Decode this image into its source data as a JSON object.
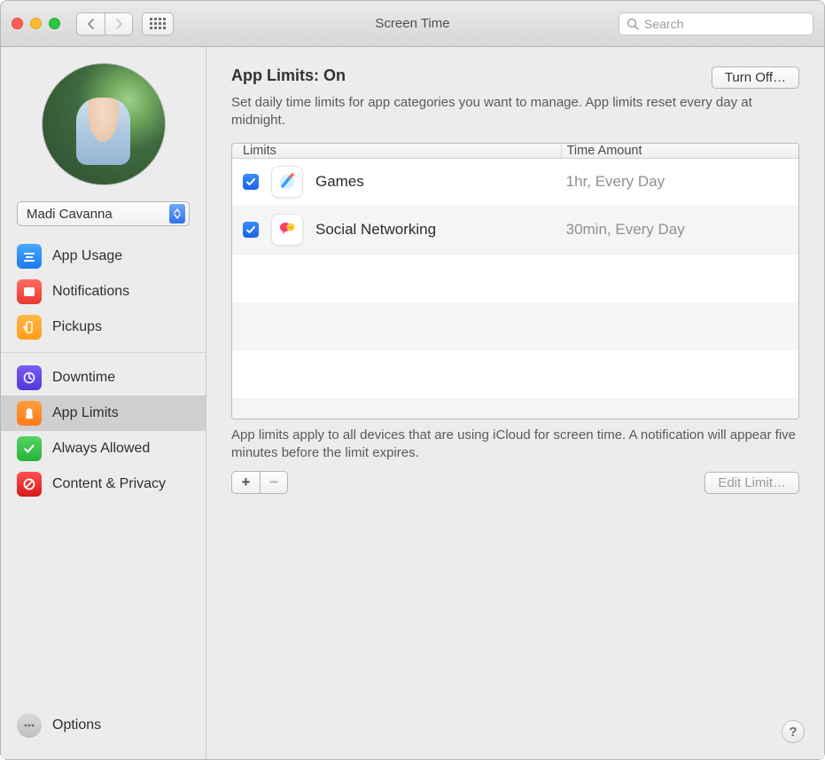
{
  "window": {
    "title": "Screen Time"
  },
  "toolbar": {
    "search_placeholder": "Search"
  },
  "sidebar": {
    "user": "Madi Cavanna",
    "groups": [
      {
        "items": [
          {
            "id": "app-usage",
            "label": "App Usage"
          },
          {
            "id": "notifications",
            "label": "Notifications"
          },
          {
            "id": "pickups",
            "label": "Pickups"
          }
        ]
      },
      {
        "items": [
          {
            "id": "downtime",
            "label": "Downtime"
          },
          {
            "id": "app-limits",
            "label": "App Limits",
            "selected": true
          },
          {
            "id": "always-allowed",
            "label": "Always Allowed"
          },
          {
            "id": "content-privacy",
            "label": "Content & Privacy"
          }
        ]
      }
    ],
    "options_label": "Options"
  },
  "content": {
    "heading_prefix": "App Limits: ",
    "heading_state": "On",
    "turn_off_label": "Turn Off…",
    "description": "Set daily time limits for app categories you want to manage. App limits reset every day at midnight.",
    "columns": {
      "limits": "Limits",
      "time": "Time Amount"
    },
    "rows": [
      {
        "checked": true,
        "icon": "games",
        "name": "Games",
        "time": "1hr, Every Day"
      },
      {
        "checked": true,
        "icon": "social",
        "name": "Social Networking",
        "time": "30min, Every Day"
      }
    ],
    "footer_note": "App limits apply to all devices that are using iCloud for screen time. A notification will appear five minutes before the limit expires.",
    "add_label": "+",
    "remove_label": "−",
    "edit_label": "Edit Limit…",
    "help_label": "?"
  }
}
